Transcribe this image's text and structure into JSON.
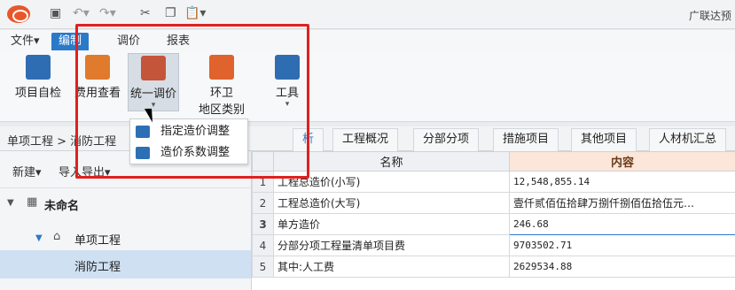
{
  "app": {
    "title": "广联达预"
  },
  "menu": {
    "file": "文件▾",
    "tabs": [
      "编制",
      "调价",
      "报表"
    ]
  },
  "ribbon": {
    "self_check": "项目自检",
    "fee_view": "费用查看",
    "unified_adjust": "统一调价",
    "env": "环卫",
    "region_type": "地区类别",
    "tools": "工具"
  },
  "dropdown": [
    "指定造价调整",
    "造价系数调整"
  ],
  "breadcrumb": "单项工程 > 消防工程",
  "tabs": [
    "析",
    "工程概况",
    "分部分项",
    "措施项目",
    "其他项目",
    "人材机汇总"
  ],
  "left_toolbar": {
    "new": "新建▾",
    "import_export": "导入导出▾"
  },
  "tree": {
    "root": "未命名",
    "child": "单项工程",
    "leaf": "消防工程"
  },
  "grid": {
    "headers": [
      "名称",
      "内容"
    ],
    "rows": [
      {
        "num": "1",
        "name": "工程总造价(小写)",
        "value": "12,548,855.14"
      },
      {
        "num": "2",
        "name": "工程总造价(大写)",
        "value": "壹仟贰佰伍拾肆万捌仟捌佰伍拾伍元…"
      },
      {
        "num": "3",
        "name": "单方造价",
        "value": "246.68"
      },
      {
        "num": "4",
        "name": "分部分项工程量清单项目费",
        "value": "9703502.71"
      },
      {
        "num": "5",
        "name": "其中:人工费",
        "value": "2629534.88"
      }
    ]
  },
  "colors": {
    "accent": "#2b79c9",
    "highlight": "#e02020"
  }
}
